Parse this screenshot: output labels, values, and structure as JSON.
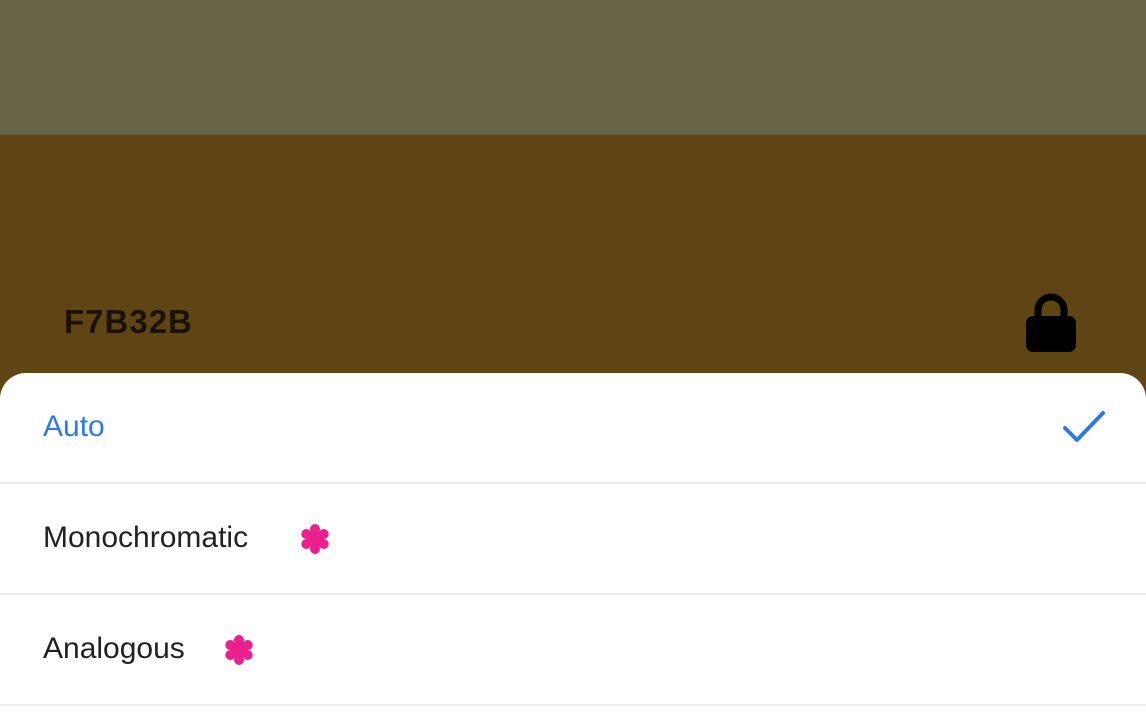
{
  "colors": {
    "top_swatch": "#696549",
    "main_swatch": "#604514",
    "accent": "#2e7be0",
    "premium_badge": "#ec1f8e"
  },
  "swatch": {
    "hex_code": "F7B32B",
    "lock_icon": "lock-icon"
  },
  "harmony_menu": {
    "options": [
      {
        "label": "Auto",
        "selected": true,
        "icon": "checkmark-icon"
      },
      {
        "label": "Monochromatic",
        "selected": false,
        "premium": true,
        "icon": "premium-badge-icon"
      },
      {
        "label": "Analogous",
        "selected": false,
        "premium": true,
        "icon": "premium-badge-icon"
      }
    ]
  }
}
